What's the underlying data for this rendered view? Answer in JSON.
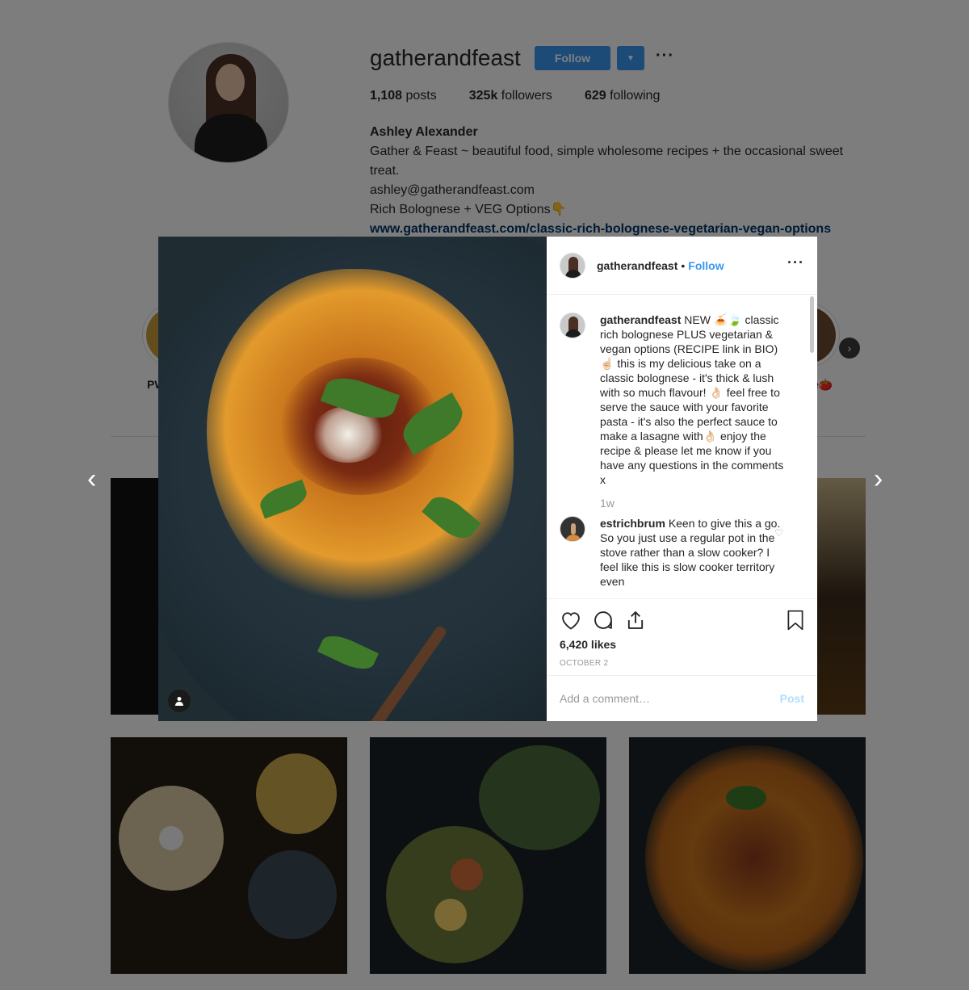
{
  "profile": {
    "username": "gatherandfeast",
    "follow_label": "Follow",
    "dropdown_icon": "caret-down-icon",
    "more_label": "···",
    "stats": {
      "posts_count": "1,108",
      "posts_label": "posts",
      "followers_count": "325k",
      "followers_label": "followers",
      "following_count": "629",
      "following_label": "following"
    },
    "bio": {
      "name": "Ashley Alexander",
      "line1": "Gather & Feast ~ beautiful food, simple wholesome recipes + the occasional sweet treat.",
      "email": "ashley@gatherandfeast.com",
      "line3": "Rich Bolognese + VEG Options👇",
      "link": "www.gatherandfeast.com/classic-rich-bolognese-vegetarian-vegan-options"
    },
    "highlights": [
      {
        "label": "PW"
      },
      {
        "label": "e🍅"
      }
    ]
  },
  "navigation": {
    "prev_arrow": "‹",
    "next_arrow": "›"
  },
  "post": {
    "header": {
      "username": "gatherandfeast",
      "separator": "•",
      "follow_label": "Follow",
      "more_label": "···"
    },
    "caption": {
      "username": "gatherandfeast",
      "text": "NEW 🍝🍃 classic rich bolognese PLUS vegetarian & vegan options (RECIPE link in BIO)☝🏻 this is my delicious take on a classic bolognese - it's thick & lush with so much flavour! 👌🏻 feel free to serve the sauce with your favorite pasta - it's also the perfect sauce to make a lasagne with👌🏻 enjoy the recipe & please let me know if you have any questions in the comments x",
      "time": "1w"
    },
    "comments": [
      {
        "username": "estrichbrum",
        "text": "Keen to give this a go. So you just use a regular pot in the stove rather than a slow cooker? I feel like this is slow cooker territory even"
      }
    ],
    "likes": "6,420 likes",
    "date": "OCTOBER 2",
    "add_comment_placeholder": "Add a comment…",
    "post_label": "Post"
  },
  "colors": {
    "accent": "#3897f0",
    "link": "#003569",
    "post_disabled": "#b2dffc"
  }
}
